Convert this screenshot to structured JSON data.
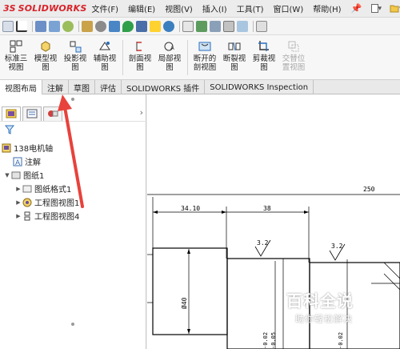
{
  "app": {
    "logo_mark": "3S",
    "logo_text": "SOLIDWORKS"
  },
  "menu": [
    "文件(F)",
    "编辑(E)",
    "视图(V)",
    "插入(I)",
    "工具(T)",
    "窗口(W)",
    "帮助(H)"
  ],
  "ribbon": {
    "buttons": [
      {
        "label": "标准三视图",
        "icon": "standard-3view-icon"
      },
      {
        "label": "模型视图",
        "icon": "model-view-icon"
      },
      {
        "label": "投影视图",
        "icon": "projected-view-icon"
      },
      {
        "label": "辅助视图",
        "icon": "auxiliary-view-icon"
      },
      {
        "label": "剖面视图",
        "icon": "section-view-icon"
      },
      {
        "label": "局部视图",
        "icon": "detail-view-icon"
      },
      {
        "label": "断开的剖视图",
        "icon": "broken-out-section-icon"
      },
      {
        "label": "断裂视图",
        "icon": "break-view-icon"
      },
      {
        "label": "剪裁视图",
        "icon": "crop-view-icon"
      },
      {
        "label": "交替位置视图",
        "icon": "alternate-position-icon",
        "disabled": true
      }
    ]
  },
  "tabs": [
    "视图布局",
    "注解",
    "草图",
    "评估",
    "SOLIDWORKS 插件",
    "SOLIDWORKS Inspection"
  ],
  "active_tab": "视图布局",
  "tree": {
    "root": "138电机轴",
    "annotation": "注解",
    "sheet": "图纸1",
    "children": [
      "图纸格式1",
      "工程图视图1",
      "工程图视图4"
    ]
  },
  "drawing": {
    "dim_overall": "250",
    "dim_a": "34.10",
    "dim_b": "38",
    "roughness_1": "3.2",
    "roughness_2": "3.2",
    "diameter": "Ø40",
    "tol_1": "-0.02",
    "tol_2": "-0.05",
    "tol_3": "-0.02"
  },
  "watermark": {
    "title": "百科全说",
    "subtitle": "助你轻松解决"
  },
  "colors": {
    "brand": "#d8232a",
    "arrow": "#e8423c",
    "accent": "#2a6ebb"
  }
}
